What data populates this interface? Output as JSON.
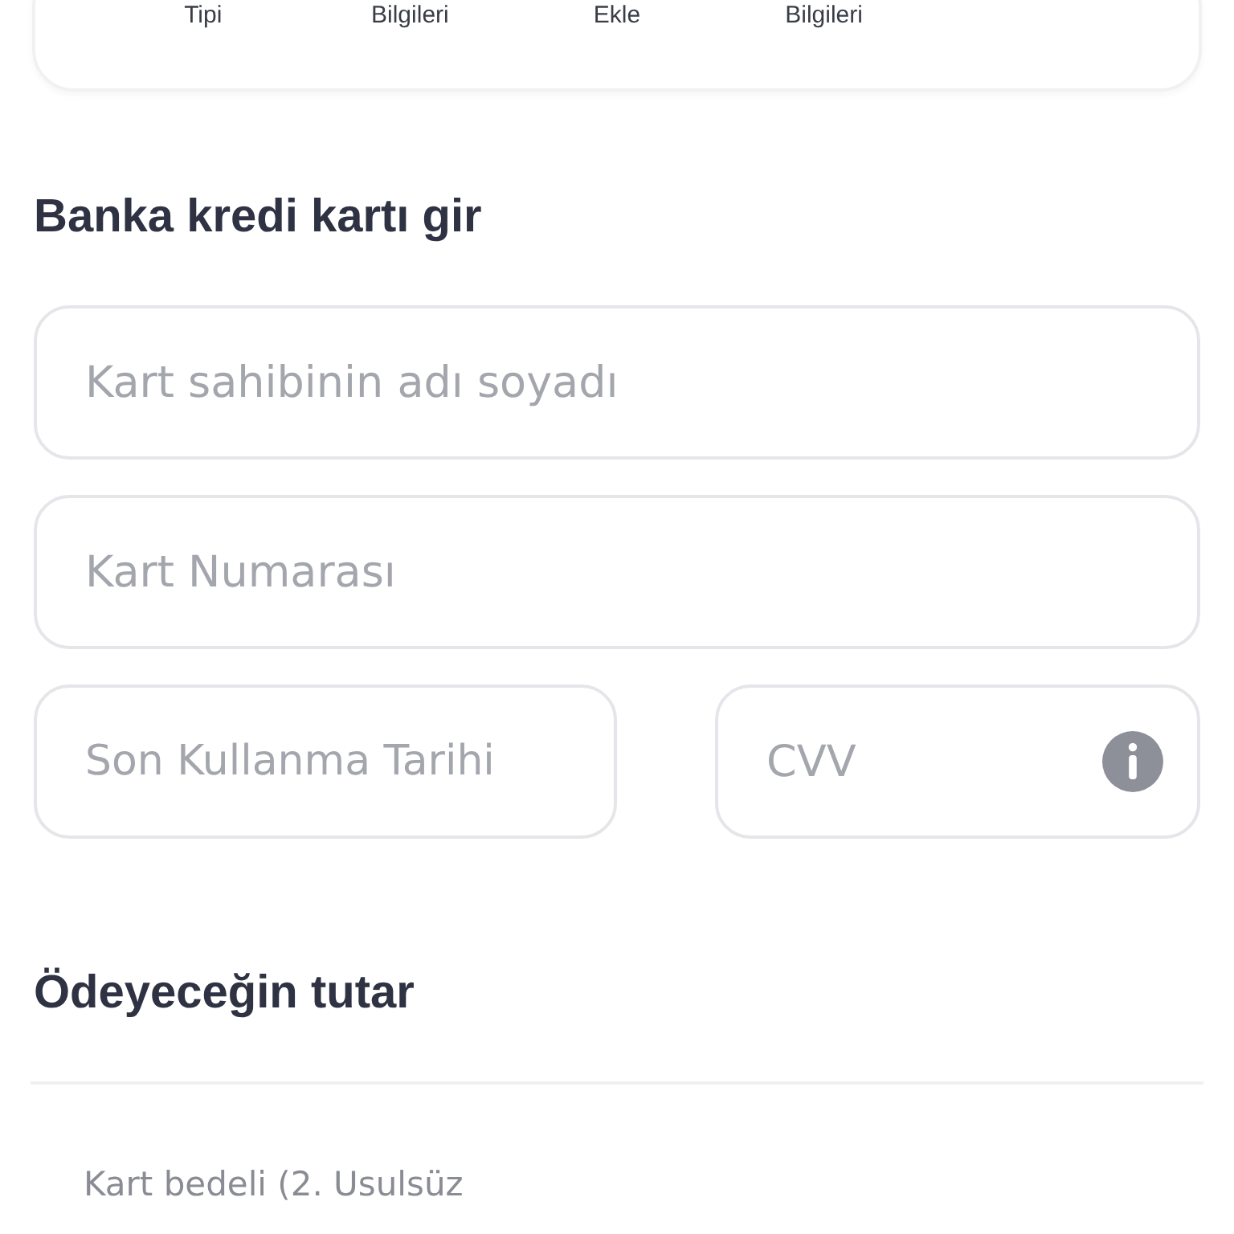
{
  "steps": [
    {
      "label": "Tipi"
    },
    {
      "label": "Bilgileri"
    },
    {
      "label": "Ekle"
    },
    {
      "label": "Bilgileri"
    }
  ],
  "card_form": {
    "title": "Banka kredi kartı gir",
    "holder": {
      "placeholder": "Kart sahibinin adı soyadı"
    },
    "number": {
      "placeholder": "Kart Numarası"
    },
    "expiry": {
      "placeholder": "Son Kullanma Tarihi"
    },
    "cvv": {
      "placeholder": "CVV"
    }
  },
  "payment": {
    "title": "Ödeyeceğin tutar",
    "rows": [
      {
        "label": "Kart bedeli (2. Usulsüz"
      }
    ]
  }
}
